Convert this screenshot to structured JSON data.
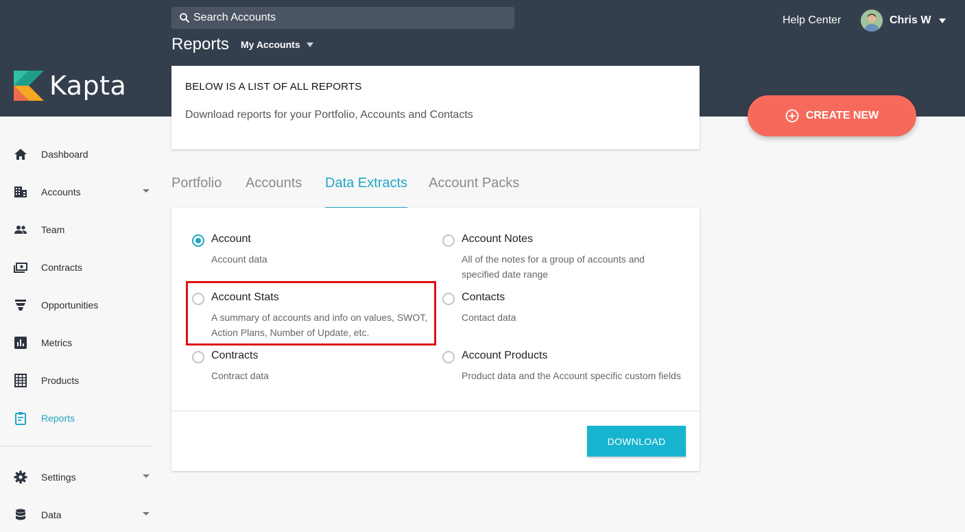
{
  "app": {
    "brand": "Kapta",
    "search_placeholder": "Search Accounts",
    "page_title": "Reports",
    "account_scope": "My Accounts",
    "help_label": "Help Center",
    "user_name": "Chris W",
    "create_label": "CREATE NEW"
  },
  "sidebar": {
    "items": [
      {
        "label": "Dashboard",
        "icon": "home-icon"
      },
      {
        "label": "Accounts",
        "icon": "building-icon"
      },
      {
        "label": "Team",
        "icon": "people-icon"
      },
      {
        "label": "Contracts",
        "icon": "money-icon"
      },
      {
        "label": "Opportunities",
        "icon": "funnel-icon"
      },
      {
        "label": "Metrics",
        "icon": "bar-chart-icon"
      },
      {
        "label": "Products",
        "icon": "grid-icon"
      },
      {
        "label": "Reports",
        "icon": "clipboard-icon"
      },
      {
        "label": "Settings",
        "icon": "gear-icon"
      },
      {
        "label": "Data",
        "icon": "database-icon"
      }
    ]
  },
  "info_card": {
    "heading": "BELOW IS A LIST OF ALL REPORTS",
    "text": "Download reports for your Portfolio, Accounts and Contacts"
  },
  "tabs": [
    "Portfolio",
    "Accounts",
    "Data Extracts",
    "Account Packs"
  ],
  "active_tab": "Data Extracts",
  "options": [
    {
      "title": "Account",
      "desc": "Account data",
      "checked": true
    },
    {
      "title": "Account Notes",
      "desc": "All of the notes for a group of accounts and specified date range",
      "checked": false
    },
    {
      "title": "Account Stats",
      "desc": "A summary of accounts and info on values, SWOT, Action Plans, Number of Update, etc.",
      "checked": false
    },
    {
      "title": "Contacts",
      "desc": "Contact data",
      "checked": false
    },
    {
      "title": "Contracts",
      "desc": "Contract data",
      "checked": false
    },
    {
      "title": "Account Products",
      "desc": "Product data and the Account specific custom fields",
      "checked": false
    }
  ],
  "download_label": "DOWNLOAD",
  "colors": {
    "header_bg": "#343f4d",
    "accent": "#1fa7c3",
    "create_button": "#f66a5c",
    "download_button": "#17b4cf",
    "highlight_box": "#e01010"
  }
}
